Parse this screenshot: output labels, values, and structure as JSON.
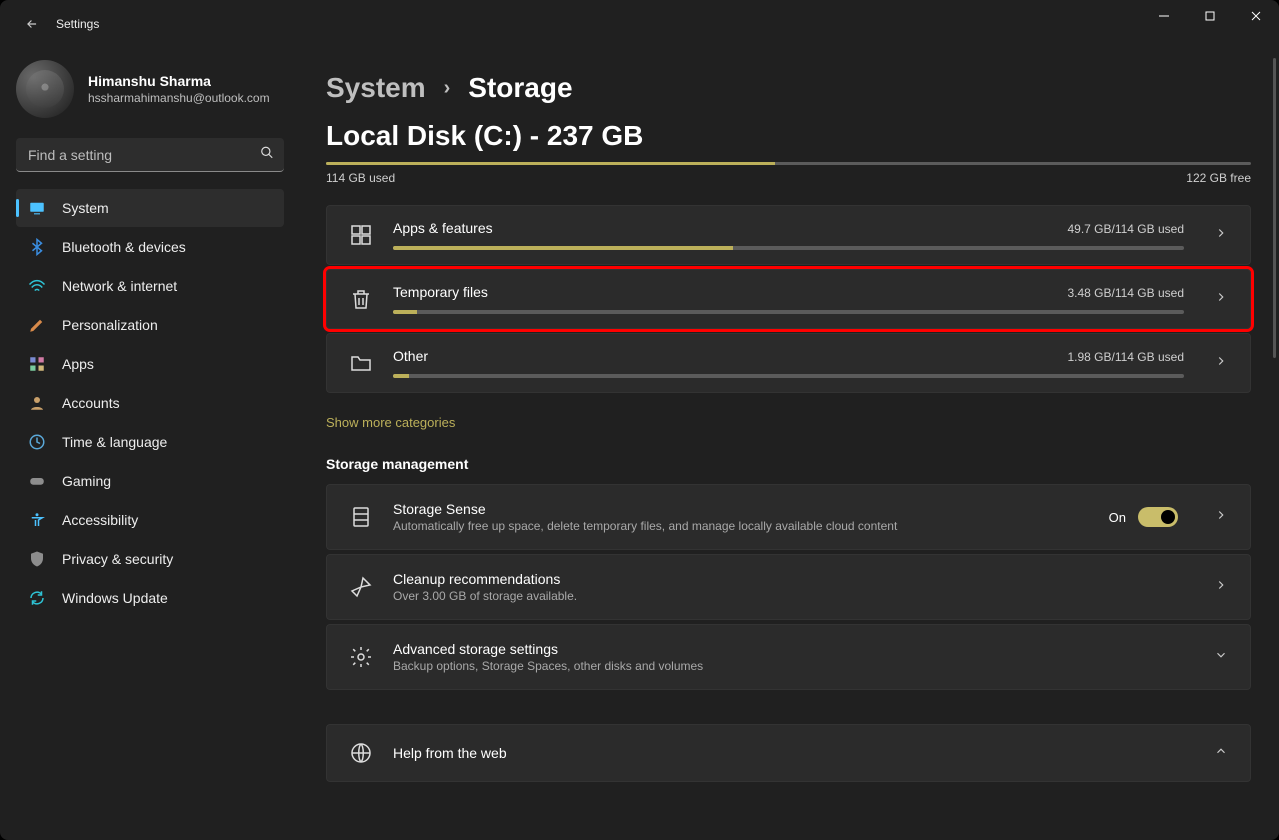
{
  "app": {
    "title": "Settings"
  },
  "profile": {
    "name": "Himanshu Sharma",
    "email": "hssharmahimanshu@outlook.com"
  },
  "search": {
    "placeholder": "Find a setting"
  },
  "nav": {
    "items": [
      {
        "label": "System"
      },
      {
        "label": "Bluetooth & devices"
      },
      {
        "label": "Network & internet"
      },
      {
        "label": "Personalization"
      },
      {
        "label": "Apps"
      },
      {
        "label": "Accounts"
      },
      {
        "label": "Time & language"
      },
      {
        "label": "Gaming"
      },
      {
        "label": "Accessibility"
      },
      {
        "label": "Privacy & security"
      },
      {
        "label": "Windows Update"
      }
    ]
  },
  "breadcrumb": {
    "parent": "System",
    "current": "Storage"
  },
  "disk": {
    "title": "Local Disk (C:) - 237 GB",
    "used_label": "114 GB used",
    "free_label": "122 GB free",
    "fill_pct": 48.5
  },
  "categories": [
    {
      "title": "Apps & features",
      "usage": "49.7 GB/114 GB used",
      "fill_pct": 43,
      "highlight": false
    },
    {
      "title": "Temporary files",
      "usage": "3.48 GB/114 GB used",
      "fill_pct": 3,
      "highlight": true
    },
    {
      "title": "Other",
      "usage": "1.98 GB/114 GB used",
      "fill_pct": 2,
      "highlight": false
    }
  ],
  "show_more": "Show more categories",
  "mgmt": {
    "section_title": "Storage management",
    "sense": {
      "title": "Storage Sense",
      "desc": "Automatically free up space, delete temporary files, and manage locally available cloud content",
      "toggle_label": "On"
    },
    "cleanup": {
      "title": "Cleanup recommendations",
      "desc": "Over 3.00 GB of storage available."
    },
    "advanced": {
      "title": "Advanced storage settings",
      "desc": "Backup options, Storage Spaces, other disks and volumes"
    },
    "help": {
      "title": "Help from the web"
    }
  }
}
